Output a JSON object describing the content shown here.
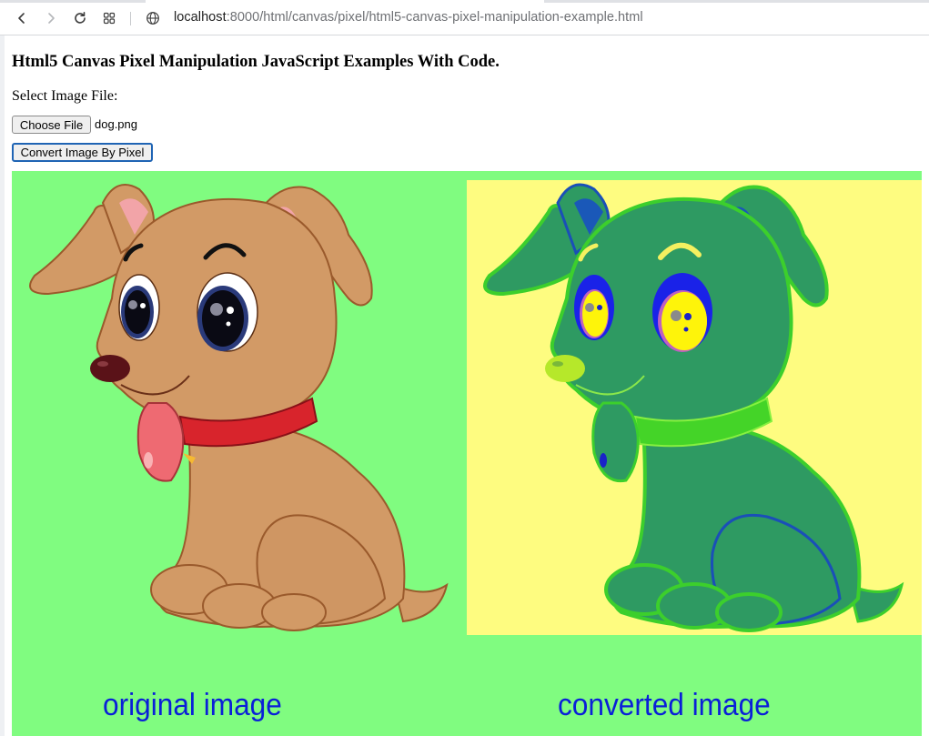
{
  "browser": {
    "url_host": "localhost",
    "url_rest": ":8000/html/canvas/pixel/html5-canvas-pixel-manipulation-example.html",
    "icons": [
      "back-icon",
      "forward-icon",
      "reload-icon",
      "tab-grid-icon",
      "site-info-icon"
    ]
  },
  "page": {
    "title": "Html5 Canvas Pixel Manipulation JavaScript Examples With Code.",
    "select_label": "Select Image File:",
    "choose_file_label": "Choose File",
    "chosen_file": "dog.png",
    "convert_button_label": "Convert Image By Pixel"
  },
  "canvas": {
    "background_color": "#80fc80",
    "converted_background_color": "#fefc80",
    "caption_color": "#0a1fd8",
    "original_caption": "original image",
    "converted_caption": "converted image",
    "original_image_alt": "cartoon brown puppy with red collar",
    "converted_image_alt": "pixel-converted green puppy on yellow background"
  }
}
